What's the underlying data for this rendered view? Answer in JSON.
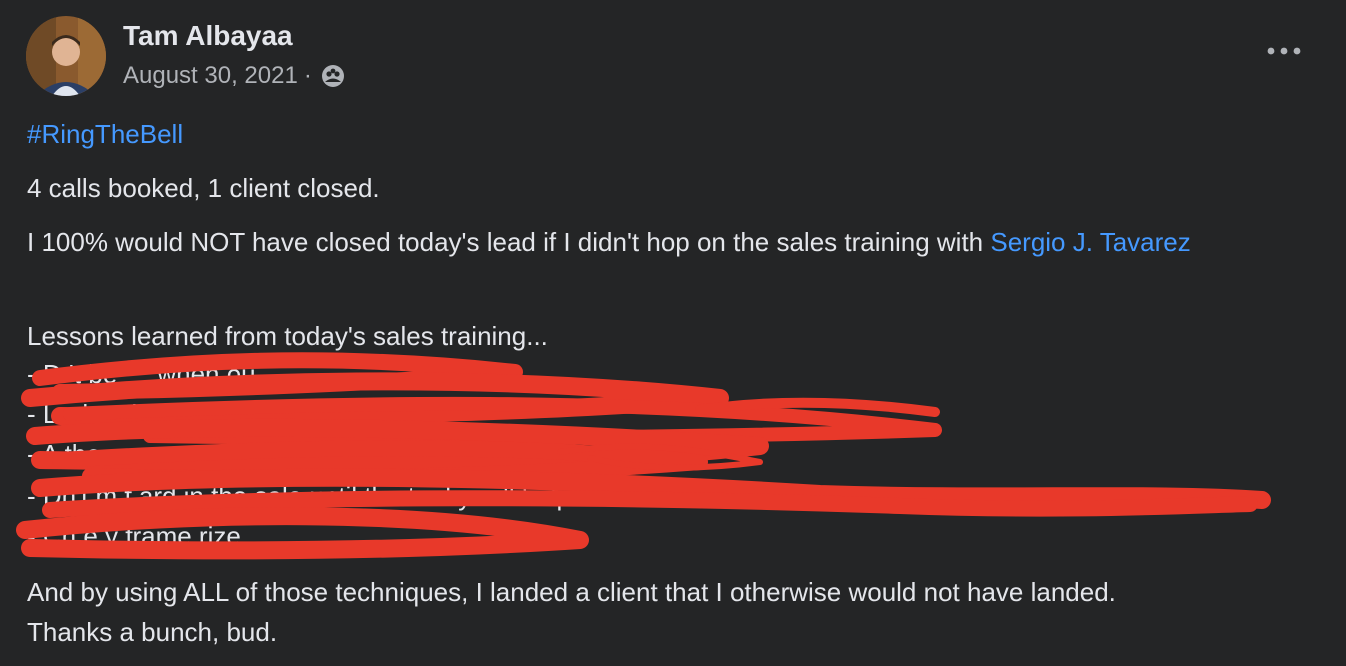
{
  "post": {
    "author_name": "Tam Albayaa",
    "date": "August 30, 2021",
    "separator": "·",
    "audience_icon": "group-icon",
    "more_icon": "more-options-icon",
    "hashtag": "#RingTheBell",
    "line_summary": "4 calls booked, 1 client closed.",
    "line_credit_pre": "I 100% would NOT have closed today's lead if I didn't hop on the sales training with ",
    "mention": "Sergio J. Tavarez",
    "lessons_heading": "Lessons learned from today's sales training...",
    "lessons": [
      "- D    't be \"       \"   when    ou       ",
      "- L    wh         asking for         (           rd)",
      "- A           the        ",
      "- Dn't m   f    ard in the sale until the t          ed y       will help them.",
      "- Ch    e y    frame          rize."
    ],
    "closing_line_1": "And by using ALL of those techniques, I landed a client that I otherwise would not have landed.",
    "closing_line_2": "Thanks a bunch, bud."
  },
  "colors": {
    "background": "#242526",
    "text": "#e4e6eb",
    "secondary_text": "#b0b3b8",
    "link": "#4599ff",
    "redaction": "#e8392a"
  }
}
